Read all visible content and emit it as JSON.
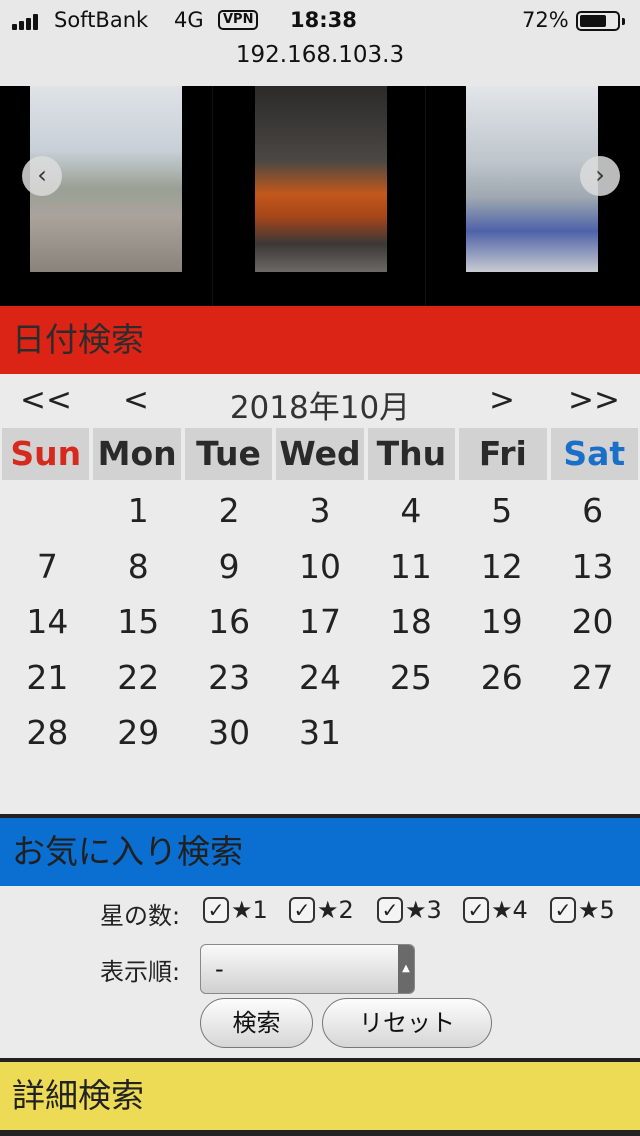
{
  "status_bar": {
    "carrier": "SoftBank",
    "network": "4G",
    "vpn": "VPN",
    "time": "18:38",
    "battery_percent": "72%",
    "battery_level": 0.72
  },
  "address_bar": {
    "url": "192.168.103.3"
  },
  "carousel": {
    "prev_icon": "chevron-left-icon",
    "next_icon": "chevron-right-icon"
  },
  "sections": {
    "date_search": "日付検索",
    "favorite_search": "お気に入り検索",
    "detail_search": "詳細検索"
  },
  "calendar": {
    "nav_first": "<<",
    "nav_prev": "<",
    "title": "2018年10月",
    "nav_next": ">",
    "nav_last": ">>",
    "weekdays": [
      "Sun",
      "Mon",
      "Tue",
      "Wed",
      "Thu",
      "Fri",
      "Sat"
    ],
    "weekday_colors": {
      "Sun": "#d52a1d",
      "Sat": "#1a6fc8"
    },
    "days": [
      "",
      "1",
      "2",
      "3",
      "4",
      "5",
      "6",
      "7",
      "8",
      "9",
      "10",
      "11",
      "12",
      "13",
      "14",
      "15",
      "16",
      "17",
      "18",
      "19",
      "20",
      "21",
      "22",
      "23",
      "24",
      "25",
      "26",
      "27",
      "28",
      "29",
      "30",
      "31",
      "",
      "",
      ""
    ]
  },
  "favorite": {
    "stars_label": "星の数:",
    "star_options": [
      "★1",
      "★2",
      "★3",
      "★4",
      "★5"
    ],
    "checkmark": "✓",
    "order_label": "表示順:",
    "order_value": "-",
    "search_button": "検索",
    "reset_button": "リセット"
  },
  "colors": {
    "date_header": "#db2416",
    "favorite_header": "#0a6fd0",
    "detail_header": "#eddb55"
  }
}
